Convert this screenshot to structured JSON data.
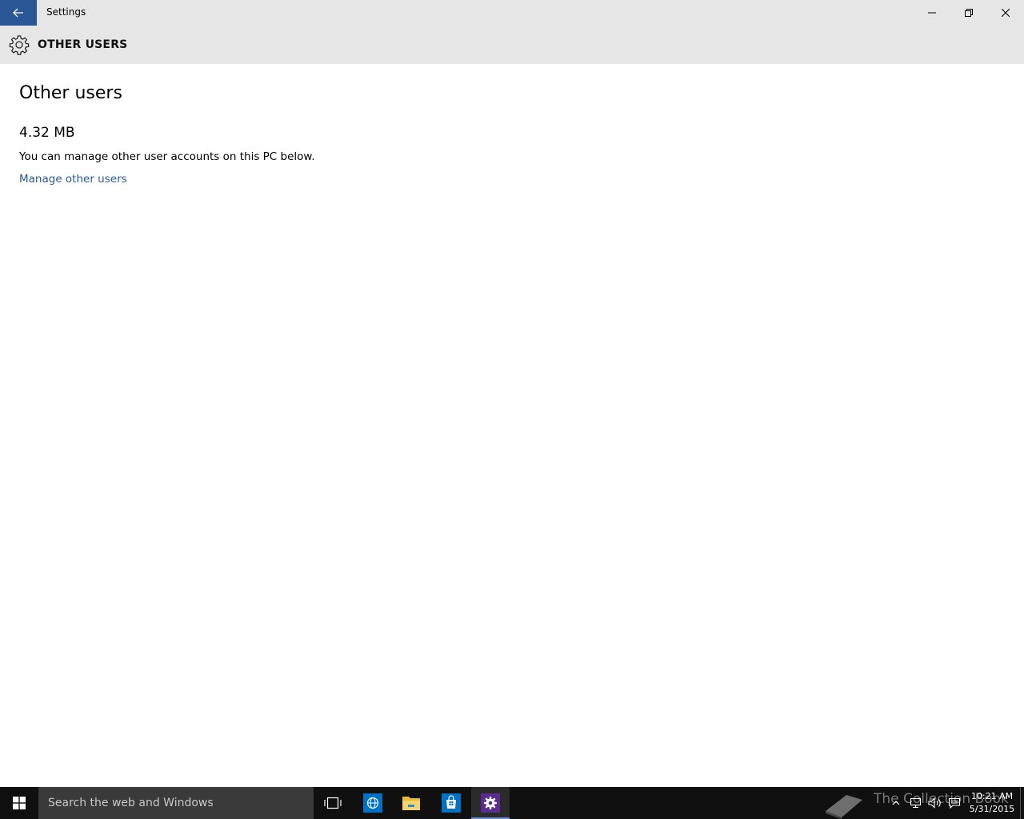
{
  "window": {
    "title": "Settings"
  },
  "header": {
    "title": "OTHER USERS"
  },
  "content": {
    "page_title": "Other users",
    "size": "4.32 MB",
    "description": "You can manage other user accounts on this PC below.",
    "manage_link": "Manage other users"
  },
  "taskbar": {
    "search_placeholder": "Search the web and Windows",
    "watermark": "The Collection Book",
    "clock": {
      "time": "10:21 AM",
      "date": "5/31/2015"
    },
    "pinned": [
      "task-view-icon",
      "internet-explorer-icon",
      "file-explorer-icon",
      "store-icon",
      "settings-icon"
    ]
  },
  "colors": {
    "accent": "#2b5797",
    "titlebar_bg": "#e6e6e6",
    "taskbar_bg": "#101010",
    "search_bg": "#3a3a3a",
    "settings_tile": "#5b2d91"
  }
}
